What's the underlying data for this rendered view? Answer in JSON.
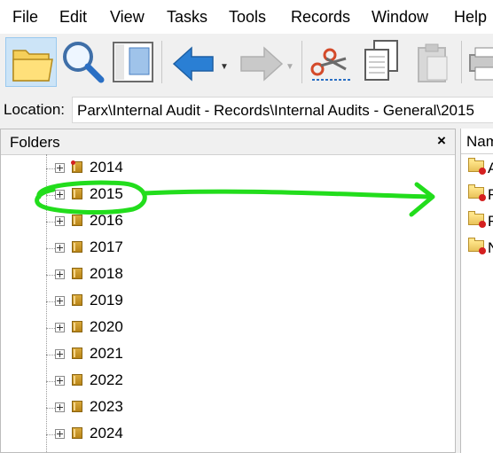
{
  "menu": [
    "File",
    "Edit",
    "View",
    "Tasks",
    "Tools",
    "Records",
    "Window",
    "Help"
  ],
  "toolbar": {
    "buttons": [
      {
        "name": "folders-button",
        "icon": "folder-icon",
        "active": true
      },
      {
        "name": "search-button",
        "icon": "magnifier-icon"
      },
      {
        "name": "preview-pane-button",
        "icon": "preview-pane-icon"
      },
      {
        "name": "back-button",
        "icon": "back-arrow-icon"
      },
      {
        "name": "forward-button",
        "icon": "forward-arrow-icon",
        "disabled": true
      },
      {
        "name": "cut-button",
        "icon": "scissors-icon"
      },
      {
        "name": "copy-button",
        "icon": "copy-icon"
      },
      {
        "name": "paste-button",
        "icon": "paste-icon",
        "disabled": true
      },
      {
        "name": "print-button",
        "icon": "printer-icon"
      }
    ]
  },
  "location": {
    "label": "Location:",
    "value": "Parx\\Internal Audit - Records\\Internal Audits - General\\2015"
  },
  "folders_panel": {
    "title": "Folders",
    "close_label": "×",
    "items": [
      {
        "label": "2014"
      },
      {
        "label": "2015"
      },
      {
        "label": "2016"
      },
      {
        "label": "2017"
      },
      {
        "label": "2018"
      },
      {
        "label": "2019"
      },
      {
        "label": "2020"
      },
      {
        "label": "2021"
      },
      {
        "label": "2022"
      },
      {
        "label": "2023"
      },
      {
        "label": "2024"
      }
    ]
  },
  "list_panel": {
    "column_header": "Nam",
    "rows": [
      {
        "label": "A"
      },
      {
        "label": "F"
      },
      {
        "label": "F"
      },
      {
        "label": "N"
      }
    ]
  },
  "colors": {
    "annotation": "#22dd1c",
    "selection": "#cce4f7",
    "back_arrow": "#2a7fd4",
    "forward_arrow": "#c8c8c8"
  }
}
